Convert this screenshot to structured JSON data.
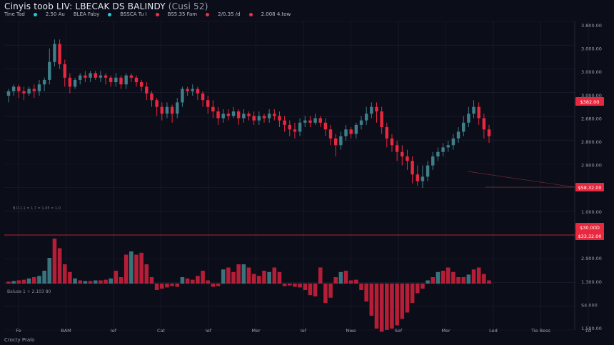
{
  "header": {
    "title": "Cinyis toob LIV: LBECAK DS BALINDY",
    "subtitle": "(Cusi 52)",
    "ohlc": [
      {
        "text": "Tine Tad",
        "color": ""
      },
      {
        "text": "2.50 Au",
        "color": "#26c6da"
      },
      {
        "text": "BLEA Faby",
        "color": ""
      },
      {
        "text": "BSSCA Tu I",
        "color": "#26c6da"
      },
      {
        "text": "BS5.35 Fam",
        "color": "#e83148"
      },
      {
        "text": "2/0.35 /d",
        "color": "#e83148"
      },
      {
        "text": "2.008 4.tow",
        "color": "#e83148"
      }
    ]
  },
  "indicator_legend": "B.0.1.1 = 1.7 = 1.05 = 1.0",
  "volume_legend": "Balusa 1 ÷ 2.103  80",
  "footer": "Crocty Pralo",
  "chart_data": {
    "type": "candlestick",
    "y_ticks": [
      "3.800.00",
      "3.000.00",
      "3.000.00",
      "3.000.00",
      "2.680.00",
      "2.800.00",
      "2.900.00",
      "1.900.00",
      "1.000.00",
      "1.500.00",
      "2.900.00",
      "1.300.00",
      "S4.000",
      "1.500.00"
    ],
    "x_ticks": [
      "Fe",
      "BAM",
      "Ief",
      "Cat",
      "Ief",
      "Mer",
      "Ief",
      "Nwe",
      "Sef",
      "Mer",
      "Led",
      "Tie Bess",
      "Ld"
    ],
    "price_tags": [
      {
        "label": "$382.00",
        "value": 0.25
      },
      {
        "label": "$58.32.00",
        "value": 0.505
      },
      {
        "label": "$30.00D",
        "value": 0.62
      },
      {
        "label": "$33.32.00",
        "value": 0.645
      }
    ],
    "hline": {
      "value": 0.645
    },
    "colors": {
      "up": "#3e7f8a",
      "down": "#e8283f",
      "grid": "#1d2233"
    },
    "candles": [
      {
        "o": 0.33,
        "c": 0.31,
        "h": 0.3,
        "l": 0.36
      },
      {
        "o": 0.31,
        "c": 0.29,
        "h": 0.28,
        "l": 0.33
      },
      {
        "o": 0.29,
        "c": 0.31,
        "h": 0.28,
        "l": 0.34
      },
      {
        "o": 0.31,
        "c": 0.32,
        "h": 0.29,
        "l": 0.35
      },
      {
        "o": 0.32,
        "c": 0.3,
        "h": 0.29,
        "l": 0.33
      },
      {
        "o": 0.3,
        "c": 0.31,
        "h": 0.28,
        "l": 0.34
      },
      {
        "o": 0.31,
        "c": 0.28,
        "h": 0.26,
        "l": 0.33
      },
      {
        "o": 0.28,
        "c": 0.26,
        "h": 0.25,
        "l": 0.31
      },
      {
        "o": 0.26,
        "c": 0.18,
        "h": 0.12,
        "l": 0.28
      },
      {
        "o": 0.18,
        "c": 0.1,
        "h": 0.08,
        "l": 0.2
      },
      {
        "o": 0.1,
        "c": 0.19,
        "h": 0.08,
        "l": 0.21
      },
      {
        "o": 0.19,
        "c": 0.25,
        "h": 0.17,
        "l": 0.29
      },
      {
        "o": 0.25,
        "c": 0.29,
        "h": 0.23,
        "l": 0.32
      },
      {
        "o": 0.29,
        "c": 0.26,
        "h": 0.25,
        "l": 0.3
      },
      {
        "o": 0.26,
        "c": 0.24,
        "h": 0.23,
        "l": 0.28
      },
      {
        "o": 0.24,
        "c": 0.25,
        "h": 0.22,
        "l": 0.27
      },
      {
        "o": 0.25,
        "c": 0.23,
        "h": 0.22,
        "l": 0.27
      },
      {
        "o": 0.23,
        "c": 0.25,
        "h": 0.22,
        "l": 0.26
      },
      {
        "o": 0.25,
        "c": 0.24,
        "h": 0.22,
        "l": 0.27
      },
      {
        "o": 0.24,
        "c": 0.25,
        "h": 0.23,
        "l": 0.28
      },
      {
        "o": 0.25,
        "c": 0.27,
        "h": 0.24,
        "l": 0.29
      },
      {
        "o": 0.27,
        "c": 0.25,
        "h": 0.23,
        "l": 0.29
      },
      {
        "o": 0.25,
        "c": 0.28,
        "h": 0.24,
        "l": 0.3
      },
      {
        "o": 0.28,
        "c": 0.24,
        "h": 0.23,
        "l": 0.3
      },
      {
        "o": 0.24,
        "c": 0.25,
        "h": 0.23,
        "l": 0.27
      },
      {
        "o": 0.25,
        "c": 0.27,
        "h": 0.24,
        "l": 0.29
      },
      {
        "o": 0.27,
        "c": 0.29,
        "h": 0.26,
        "l": 0.31
      },
      {
        "o": 0.29,
        "c": 0.32,
        "h": 0.27,
        "l": 0.35
      },
      {
        "o": 0.32,
        "c": 0.35,
        "h": 0.31,
        "l": 0.38
      },
      {
        "o": 0.35,
        "c": 0.38,
        "h": 0.34,
        "l": 0.42
      },
      {
        "o": 0.38,
        "c": 0.41,
        "h": 0.36,
        "l": 0.44
      },
      {
        "o": 0.41,
        "c": 0.38,
        "h": 0.36,
        "l": 0.43
      },
      {
        "o": 0.38,
        "c": 0.41,
        "h": 0.37,
        "l": 0.45
      },
      {
        "o": 0.41,
        "c": 0.36,
        "h": 0.34,
        "l": 0.43
      },
      {
        "o": 0.36,
        "c": 0.3,
        "h": 0.29,
        "l": 0.38
      },
      {
        "o": 0.3,
        "c": 0.31,
        "h": 0.29,
        "l": 0.33
      },
      {
        "o": 0.31,
        "c": 0.3,
        "h": 0.28,
        "l": 0.33
      },
      {
        "o": 0.3,
        "c": 0.32,
        "h": 0.29,
        "l": 0.35
      },
      {
        "o": 0.32,
        "c": 0.35,
        "h": 0.31,
        "l": 0.38
      },
      {
        "o": 0.35,
        "c": 0.38,
        "h": 0.33,
        "l": 0.41
      },
      {
        "o": 0.38,
        "c": 0.4,
        "h": 0.35,
        "l": 0.43
      },
      {
        "o": 0.4,
        "c": 0.43,
        "h": 0.38,
        "l": 0.46
      },
      {
        "o": 0.43,
        "c": 0.41,
        "h": 0.39,
        "l": 0.45
      },
      {
        "o": 0.41,
        "c": 0.42,
        "h": 0.39,
        "l": 0.44
      },
      {
        "o": 0.42,
        "c": 0.4,
        "h": 0.38,
        "l": 0.43
      },
      {
        "o": 0.4,
        "c": 0.43,
        "h": 0.39,
        "l": 0.46
      },
      {
        "o": 0.43,
        "c": 0.41,
        "h": 0.39,
        "l": 0.45
      },
      {
        "o": 0.41,
        "c": 0.42,
        "h": 0.4,
        "l": 0.44
      },
      {
        "o": 0.42,
        "c": 0.44,
        "h": 0.4,
        "l": 0.46
      },
      {
        "o": 0.44,
        "c": 0.42,
        "h": 0.4,
        "l": 0.46
      },
      {
        "o": 0.42,
        "c": 0.43,
        "h": 0.41,
        "l": 0.45
      },
      {
        "o": 0.43,
        "c": 0.41,
        "h": 0.39,
        "l": 0.45
      },
      {
        "o": 0.41,
        "c": 0.42,
        "h": 0.39,
        "l": 0.44
      },
      {
        "o": 0.42,
        "c": 0.44,
        "h": 0.4,
        "l": 0.47
      },
      {
        "o": 0.44,
        "c": 0.46,
        "h": 0.42,
        "l": 0.49
      },
      {
        "o": 0.46,
        "c": 0.48,
        "h": 0.44,
        "l": 0.51
      },
      {
        "o": 0.48,
        "c": 0.49,
        "h": 0.45,
        "l": 0.52
      },
      {
        "o": 0.49,
        "c": 0.45,
        "h": 0.43,
        "l": 0.51
      },
      {
        "o": 0.45,
        "c": 0.44,
        "h": 0.42,
        "l": 0.47
      },
      {
        "o": 0.44,
        "c": 0.45,
        "h": 0.42,
        "l": 0.47
      },
      {
        "o": 0.45,
        "c": 0.43,
        "h": 0.41,
        "l": 0.46
      },
      {
        "o": 0.43,
        "c": 0.45,
        "h": 0.42,
        "l": 0.47
      },
      {
        "o": 0.45,
        "c": 0.48,
        "h": 0.43,
        "l": 0.51
      },
      {
        "o": 0.48,
        "c": 0.52,
        "h": 0.46,
        "l": 0.55
      },
      {
        "o": 0.52,
        "c": 0.55,
        "h": 0.5,
        "l": 0.6
      },
      {
        "o": 0.55,
        "c": 0.51,
        "h": 0.49,
        "l": 0.57
      },
      {
        "o": 0.51,
        "c": 0.48,
        "h": 0.46,
        "l": 0.53
      },
      {
        "o": 0.48,
        "c": 0.5,
        "h": 0.47,
        "l": 0.52
      },
      {
        "o": 0.5,
        "c": 0.46,
        "h": 0.45,
        "l": 0.52
      },
      {
        "o": 0.46,
        "c": 0.44,
        "h": 0.42,
        "l": 0.48
      },
      {
        "o": 0.44,
        "c": 0.41,
        "h": 0.38,
        "l": 0.46
      },
      {
        "o": 0.41,
        "c": 0.38,
        "h": 0.36,
        "l": 0.43
      },
      {
        "o": 0.38,
        "c": 0.4,
        "h": 0.36,
        "l": 0.45
      },
      {
        "o": 0.4,
        "c": 0.47,
        "h": 0.38,
        "l": 0.5
      },
      {
        "o": 0.47,
        "c": 0.52,
        "h": 0.45,
        "l": 0.56
      },
      {
        "o": 0.52,
        "c": 0.55,
        "h": 0.5,
        "l": 0.58
      },
      {
        "o": 0.55,
        "c": 0.58,
        "h": 0.53,
        "l": 0.62
      },
      {
        "o": 0.58,
        "c": 0.6,
        "h": 0.55,
        "l": 0.64
      },
      {
        "o": 0.6,
        "c": 0.62,
        "h": 0.57,
        "l": 0.66
      },
      {
        "o": 0.62,
        "c": 0.68,
        "h": 0.6,
        "l": 0.72
      },
      {
        "o": 0.68,
        "c": 0.71,
        "h": 0.64,
        "l": 0.73
      },
      {
        "o": 0.71,
        "c": 0.69,
        "h": 0.64,
        "l": 0.74
      },
      {
        "o": 0.69,
        "c": 0.64,
        "h": 0.62,
        "l": 0.71
      },
      {
        "o": 0.64,
        "c": 0.6,
        "h": 0.58,
        "l": 0.66
      },
      {
        "o": 0.6,
        "c": 0.58,
        "h": 0.56,
        "l": 0.62
      },
      {
        "o": 0.58,
        "c": 0.56,
        "h": 0.54,
        "l": 0.6
      },
      {
        "o": 0.56,
        "c": 0.55,
        "h": 0.53,
        "l": 0.58
      },
      {
        "o": 0.55,
        "c": 0.52,
        "h": 0.5,
        "l": 0.57
      },
      {
        "o": 0.52,
        "c": 0.49,
        "h": 0.47,
        "l": 0.54
      },
      {
        "o": 0.49,
        "c": 0.45,
        "h": 0.42,
        "l": 0.51
      },
      {
        "o": 0.45,
        "c": 0.41,
        "h": 0.38,
        "l": 0.47
      },
      {
        "o": 0.41,
        "c": 0.38,
        "h": 0.35,
        "l": 0.43
      },
      {
        "o": 0.38,
        "c": 0.43,
        "h": 0.36,
        "l": 0.46
      },
      {
        "o": 0.43,
        "c": 0.48,
        "h": 0.41,
        "l": 0.52
      },
      {
        "o": 0.48,
        "c": 0.51,
        "h": 0.46,
        "l": 0.54
      }
    ],
    "volume": [
      {
        "v": 0.03,
        "d": 1
      },
      {
        "v": 0.04,
        "d": 0
      },
      {
        "v": 0.05,
        "d": 1
      },
      {
        "v": 0.06,
        "d": 1
      },
      {
        "v": 0.08,
        "d": 0
      },
      {
        "v": 0.1,
        "d": 1
      },
      {
        "v": 0.12,
        "d": 0
      },
      {
        "v": 0.2,
        "d": 0
      },
      {
        "v": 0.4,
        "d": 0
      },
      {
        "v": 0.7,
        "d": 1
      },
      {
        "v": 0.55,
        "d": 1
      },
      {
        "v": 0.3,
        "d": 1
      },
      {
        "v": 0.18,
        "d": 1
      },
      {
        "v": 0.08,
        "d": 0
      },
      {
        "v": 0.05,
        "d": 1
      },
      {
        "v": 0.04,
        "d": 0
      },
      {
        "v": 0.04,
        "d": 1
      },
      {
        "v": 0.05,
        "d": 0
      },
      {
        "v": 0.05,
        "d": 1
      },
      {
        "v": 0.06,
        "d": 1
      },
      {
        "v": 0.08,
        "d": 0
      },
      {
        "v": 0.2,
        "d": 1
      },
      {
        "v": 0.1,
        "d": 1
      },
      {
        "v": 0.45,
        "d": 1
      },
      {
        "v": 0.5,
        "d": 0
      },
      {
        "v": 0.45,
        "d": 1
      },
      {
        "v": 0.48,
        "d": 1
      },
      {
        "v": 0.3,
        "d": 1
      },
      {
        "v": 0.1,
        "d": 1
      },
      {
        "v": -0.1,
        "d": 1
      },
      {
        "v": -0.08,
        "d": 1
      },
      {
        "v": -0.06,
        "d": 1
      },
      {
        "v": -0.04,
        "d": 1
      },
      {
        "v": -0.05,
        "d": 1
      },
      {
        "v": 0.1,
        "d": 0
      },
      {
        "v": 0.08,
        "d": 1
      },
      {
        "v": 0.06,
        "d": 1
      },
      {
        "v": 0.12,
        "d": 1
      },
      {
        "v": 0.2,
        "d": 1
      },
      {
        "v": 0.05,
        "d": 1
      },
      {
        "v": -0.05,
        "d": 1
      },
      {
        "v": -0.04,
        "d": 1
      },
      {
        "v": 0.22,
        "d": 0
      },
      {
        "v": 0.25,
        "d": 1
      },
      {
        "v": 0.18,
        "d": 1
      },
      {
        "v": 0.3,
        "d": 1
      },
      {
        "v": 0.3,
        "d": 0
      },
      {
        "v": 0.25,
        "d": 1
      },
      {
        "v": 0.15,
        "d": 1
      },
      {
        "v": 0.12,
        "d": 1
      },
      {
        "v": 0.2,
        "d": 1
      },
      {
        "v": 0.18,
        "d": 0
      },
      {
        "v": 0.25,
        "d": 1
      },
      {
        "v": 0.18,
        "d": 1
      },
      {
        "v": -0.04,
        "d": 1
      },
      {
        "v": -0.03,
        "d": 1
      },
      {
        "v": -0.05,
        "d": 1
      },
      {
        "v": -0.06,
        "d": 1
      },
      {
        "v": -0.1,
        "d": 1
      },
      {
        "v": -0.18,
        "d": 1
      },
      {
        "v": -0.2,
        "d": 1
      },
      {
        "v": 0.25,
        "d": 1
      },
      {
        "v": -0.3,
        "d": 1
      },
      {
        "v": -0.22,
        "d": 1
      },
      {
        "v": 0.1,
        "d": 1
      },
      {
        "v": 0.18,
        "d": 0
      },
      {
        "v": 0.2,
        "d": 1
      },
      {
        "v": 0.05,
        "d": 1
      },
      {
        "v": 0.06,
        "d": 1
      },
      {
        "v": -0.1,
        "d": 1
      },
      {
        "v": -0.28,
        "d": 1
      },
      {
        "v": -0.5,
        "d": 1
      },
      {
        "v": -0.7,
        "d": 1
      },
      {
        "v": -0.75,
        "d": 1
      },
      {
        "v": -0.72,
        "d": 1
      },
      {
        "v": -0.7,
        "d": 1
      },
      {
        "v": -0.65,
        "d": 1
      },
      {
        "v": -0.55,
        "d": 1
      },
      {
        "v": -0.45,
        "d": 1
      },
      {
        "v": -0.3,
        "d": 1
      },
      {
        "v": -0.15,
        "d": 1
      },
      {
        "v": -0.08,
        "d": 1
      },
      {
        "v": 0.05,
        "d": 0
      },
      {
        "v": 0.1,
        "d": 1
      },
      {
        "v": 0.18,
        "d": 0
      },
      {
        "v": 0.2,
        "d": 1
      },
      {
        "v": 0.25,
        "d": 1
      },
      {
        "v": 0.18,
        "d": 1
      },
      {
        "v": 0.1,
        "d": 1
      },
      {
        "v": 0.1,
        "d": 1
      },
      {
        "v": 0.14,
        "d": 0
      },
      {
        "v": 0.22,
        "d": 1
      },
      {
        "v": 0.25,
        "d": 1
      },
      {
        "v": 0.15,
        "d": 1
      },
      {
        "v": 0.05,
        "d": 1
      }
    ]
  }
}
